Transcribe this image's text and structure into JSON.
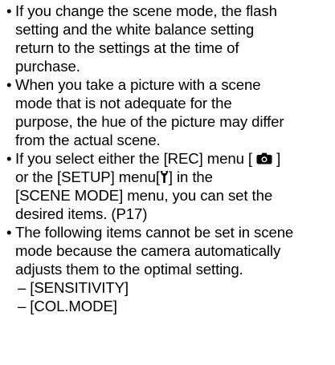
{
  "bullets": [
    {
      "lines": [
        "If you change the scene mode, the flash",
        "setting and the white balance setting",
        "return to the settings at the time of",
        "purchase."
      ]
    },
    {
      "lines": [
        "When you take a picture with a scene",
        "mode that is not adequate for the",
        "purpose, the hue of the picture may differ",
        "from the actual scene."
      ]
    },
    {
      "line1_before": "If you select either the [REC] menu [",
      "line1_after": "]",
      "line2_before": "or the [SETUP] menu[",
      "line2_after": "] in the",
      "line3": "[SCENE MODE] menu, you can set the",
      "line4": "desired items. (P17)",
      "rec_icon": "camera-icon",
      "setup_icon": "wrench-icon"
    },
    {
      "lines": [
        "The following items cannot be set in scene",
        "mode because the camera automatically",
        "adjusts them to the optimal setting."
      ],
      "sub_items": [
        "– [SENSITIVITY]",
        "– [COL.MODE]"
      ]
    }
  ]
}
